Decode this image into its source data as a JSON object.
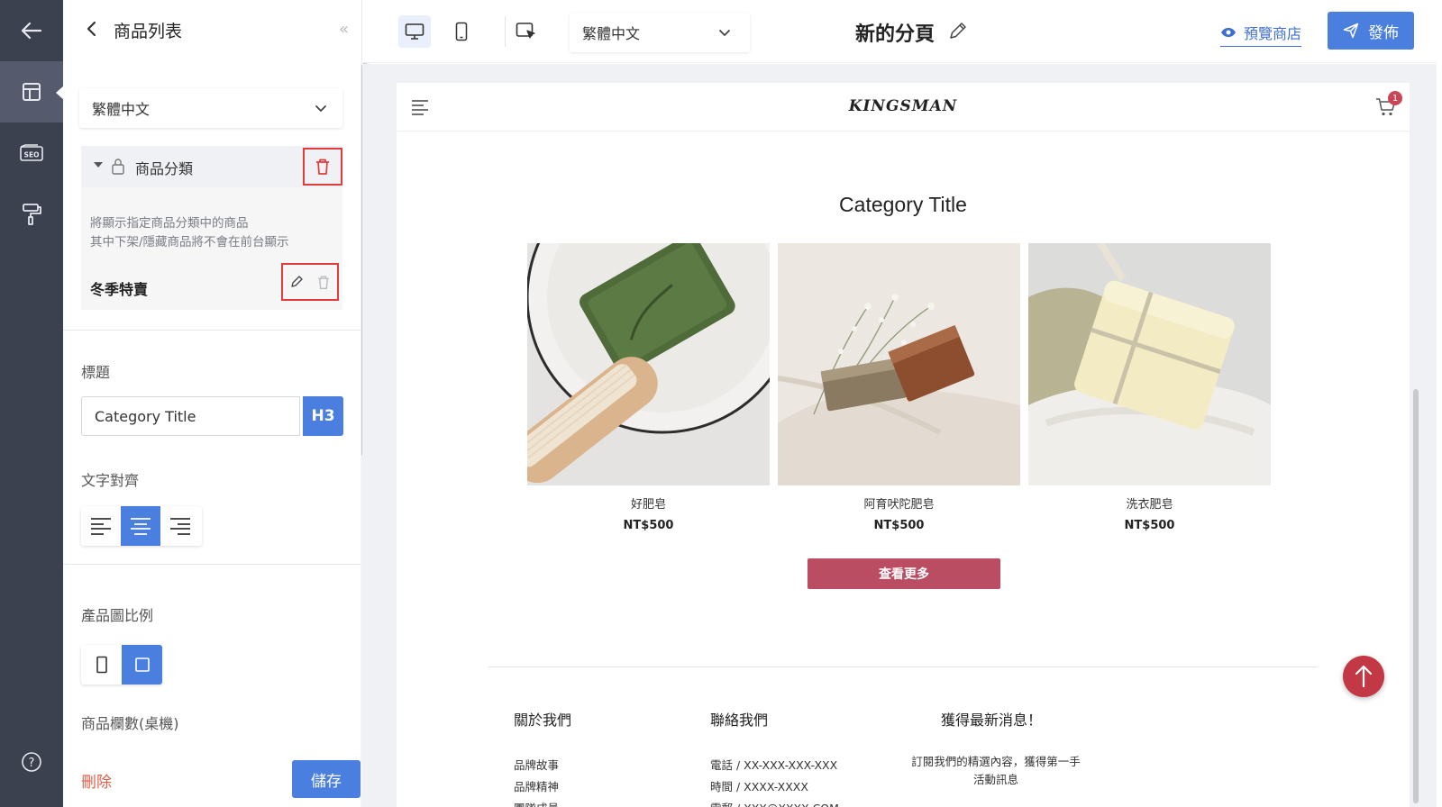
{
  "rail": {
    "items": [
      {
        "name": "back-arrow-icon"
      },
      {
        "name": "layout-icon"
      },
      {
        "name": "seo-icon",
        "label": "SEO"
      },
      {
        "name": "paint-roller-icon"
      },
      {
        "name": "help-icon",
        "label": "?"
      }
    ]
  },
  "panel": {
    "title": "商品列表",
    "collapse": "«",
    "language": "繁體中文",
    "category": {
      "label": "商品分類",
      "description_1": "將顯示指定商品分類中的商品",
      "description_2": "其中下架/隱藏商品將不會在前台顯示",
      "selected": "冬季特賣"
    },
    "title_label": "標題",
    "title_value": "Category Title",
    "heading_level": "H3",
    "align_label": "文字對齊",
    "align_active": "center",
    "ratio_label": "產品圖比例",
    "ratio_active": "square",
    "columns_label": "商品欄數(桌機)",
    "delete": "刪除",
    "save": "儲存"
  },
  "toolbar": {
    "language": "繁體中文",
    "page_name": "新的分頁",
    "preview": "預覽商店",
    "publish": "發佈",
    "active_device": "desktop"
  },
  "store": {
    "brand": "KINGSMAN",
    "cart_count": "1",
    "category_title": "Category Title",
    "products": [
      {
        "name": "好肥皂",
        "price": "NT$500"
      },
      {
        "name": "阿育吠陀肥皂",
        "price": "NT$500"
      },
      {
        "name": "洗衣肥皂",
        "price": "NT$500"
      }
    ],
    "more": "查看更多",
    "footer": {
      "about": {
        "title": "關於我們",
        "items": [
          "品牌故事",
          "品牌精神",
          "團隊成員"
        ]
      },
      "contact": {
        "title": "聯絡我們",
        "items": [
          "電話 / XX-XXX-XXX-XXX",
          "時間 / XXXX-XXXX",
          "電郵 / XXX@XXXX.COM"
        ]
      },
      "news": {
        "title": "獲得最新消息！",
        "desc": "訂閱我們的精選內容，獲得第一手活動訊息"
      }
    }
  },
  "colors": {
    "rail": "#3c4150",
    "accent": "#4a7fe0",
    "highlight_border": "#e23b3b",
    "more_button": "#bb4d63",
    "to_top": "#c33845"
  }
}
